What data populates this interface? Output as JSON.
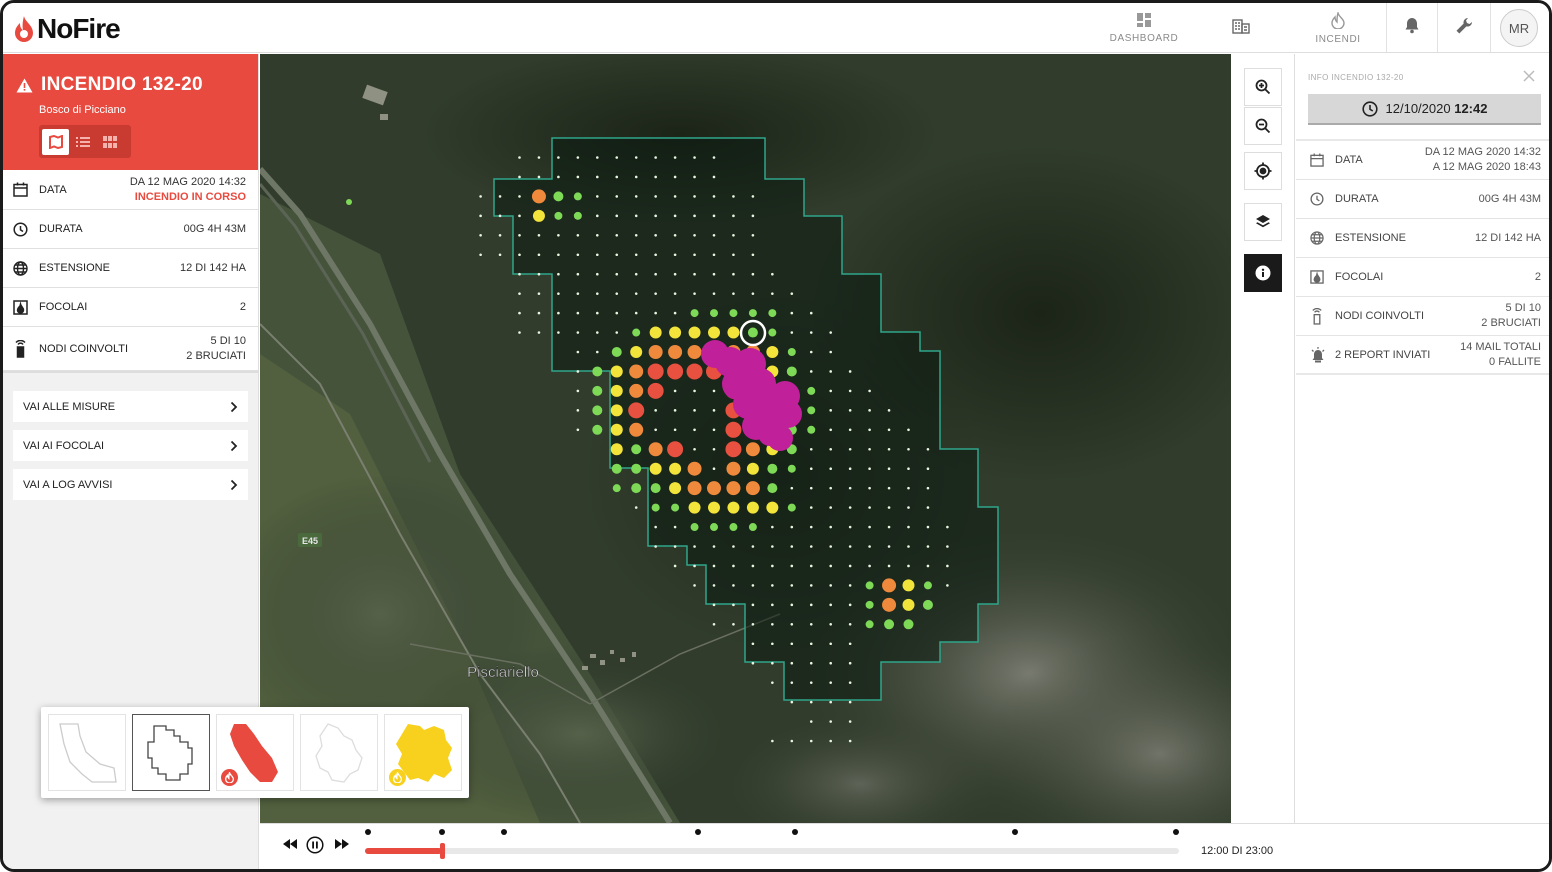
{
  "app": {
    "name": "NoFire"
  },
  "nav": {
    "items": [
      {
        "label": "DASHBOARD",
        "icon": "dashboard-icon"
      },
      {
        "label": "",
        "icon": "buildings-icon"
      },
      {
        "label": "INCENDI",
        "icon": "fire-icon"
      }
    ],
    "user_initials": "MR"
  },
  "incident": {
    "title": "INCENDIO 132-20",
    "location": "Bosco di Picciano",
    "views": [
      "map-view",
      "list-view",
      "grid-view"
    ],
    "rows": [
      {
        "label": "DATA",
        "value": "DA 12 MAG 2020 14:32",
        "value2": "INCENDIO IN CORSO",
        "icon": "calendar-icon"
      },
      {
        "label": "DURATA",
        "value": "00G 4H 43M",
        "value2": "",
        "icon": "timer-icon"
      },
      {
        "label": "ESTENSIONE",
        "value": "12 DI 142 HA",
        "value2": "",
        "icon": "globe-icon"
      },
      {
        "label": "FOCOLAI",
        "value": "2",
        "value2": "",
        "icon": "focolai-icon"
      },
      {
        "label": "NODI COINVOLTI",
        "value": "5 DI 10",
        "value2": "2 BRUCIATI",
        "icon": "sensor-node-icon"
      }
    ],
    "links": [
      "VAI ALLE MISURE",
      "VAI AI FOCOLAI",
      "VAI A LOG AVVISI"
    ]
  },
  "map": {
    "labels": {
      "road": "E45",
      "place": "Pisciariello"
    },
    "colors": {
      "low": "#7ed957",
      "mid": "#f2e43a",
      "high": "#ef8a3d",
      "critical": "#e8503f",
      "burned": "#c0209a",
      "perimeter": "#2fa58a"
    }
  },
  "info_panel": {
    "title": "INFO INCENDIO 132-20",
    "datetime_date": "12/10/2020",
    "datetime_time": "12:42",
    "rows": [
      {
        "label": "DATA",
        "value": "DA 12 MAG 2020 14:32",
        "value2": "A 12 MAG 2020 18:43",
        "icon": "calendar-icon"
      },
      {
        "label": "DURATA",
        "value": "00G 4H 43M",
        "value2": "",
        "icon": "timer-icon"
      },
      {
        "label": "ESTENSIONE",
        "value": "12 DI 142 HA",
        "value2": "",
        "icon": "globe-icon"
      },
      {
        "label": "FOCOLAI",
        "value": "2",
        "value2": "",
        "icon": "focolai-icon"
      },
      {
        "label": "NODI COINVOLTI",
        "value": "5 DI 10",
        "value2": "2 BRUCIATI",
        "icon": "sensor-node-icon"
      },
      {
        "label": "2 REPORT INVIATI",
        "value": "14 MAIL TOTALI",
        "value2": "0 FALLITE",
        "icon": "alarm-icon"
      }
    ]
  },
  "timeline": {
    "current": "12:00 DI 23:00",
    "progress": 0.095
  },
  "layers": [
    {
      "name": "area-outline",
      "active": false
    },
    {
      "name": "grid-outline",
      "active": true
    },
    {
      "name": "fire-area",
      "active": false
    },
    {
      "name": "region-outline",
      "active": false
    },
    {
      "name": "risk-area",
      "active": false
    }
  ]
}
